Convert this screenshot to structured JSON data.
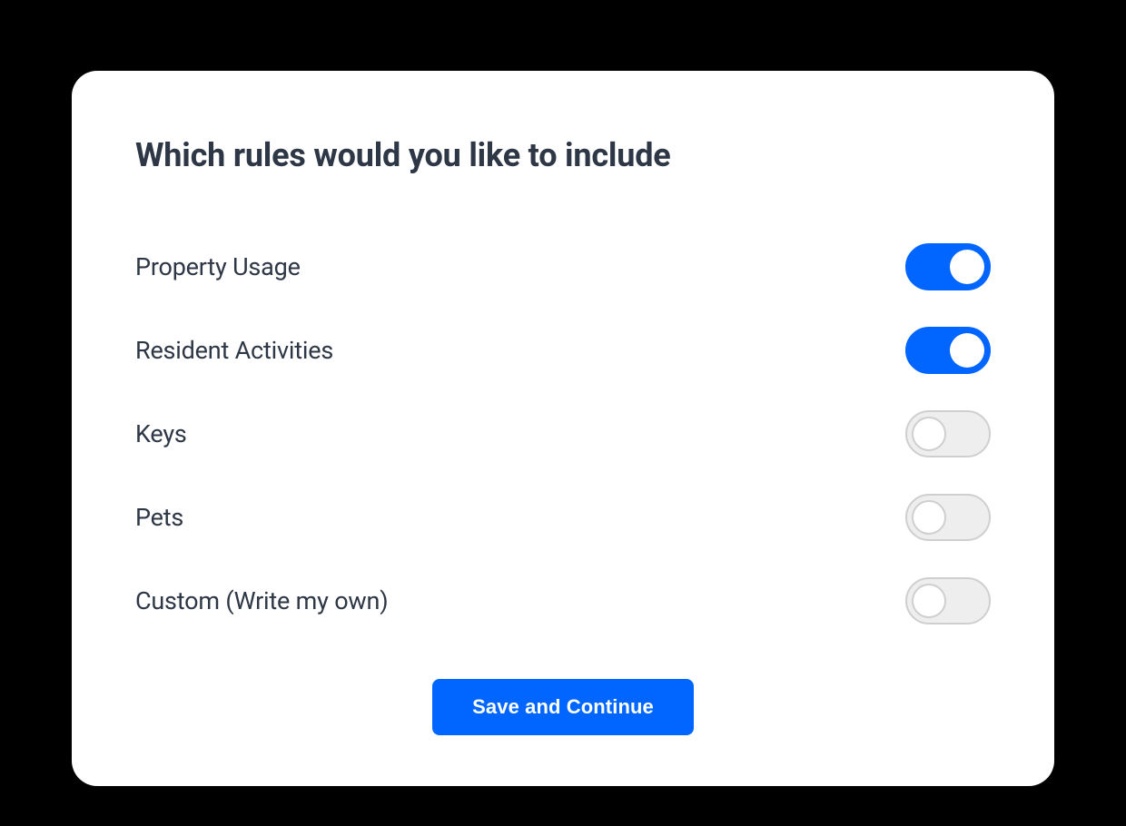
{
  "heading": "Which rules would you like to include",
  "rules": [
    {
      "id": "property-usage",
      "label": "Property Usage",
      "enabled": true
    },
    {
      "id": "resident-activities",
      "label": "Resident Activities",
      "enabled": true
    },
    {
      "id": "keys",
      "label": "Keys",
      "enabled": false
    },
    {
      "id": "pets",
      "label": "Pets",
      "enabled": false
    },
    {
      "id": "custom",
      "label": "Custom (Write my own)",
      "enabled": false
    }
  ],
  "actions": {
    "save_label": "Save and Continue"
  },
  "colors": {
    "accent": "#0066ff",
    "text": "#2e3745",
    "toggle_off_bg": "#eeeeee",
    "toggle_off_border": "#cfcfcf"
  }
}
